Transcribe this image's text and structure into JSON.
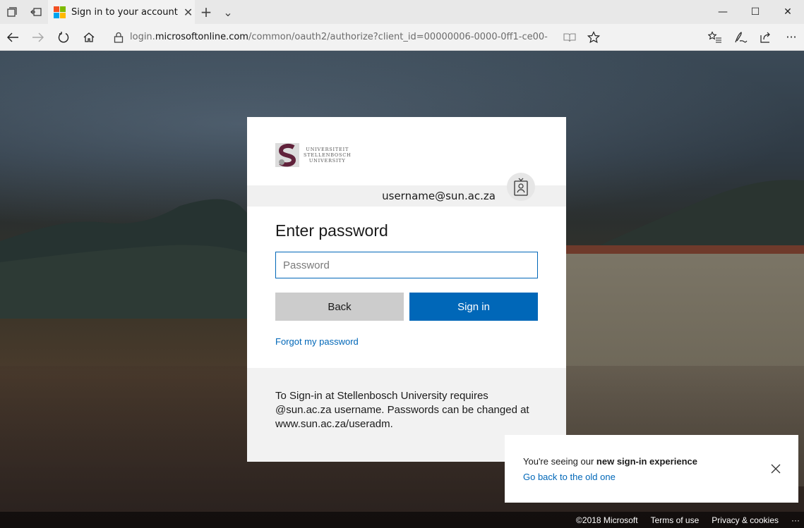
{
  "browser": {
    "tab": {
      "title": "Sign in to your account",
      "close": "✕"
    },
    "new_tab": "+",
    "tab_menu": "⌄",
    "window": {
      "minimize": "—",
      "maximize": "☐",
      "close": "✕"
    },
    "address": {
      "prefix": "login.",
      "domain": "microsoftonline.com",
      "path": "/common/oauth2/authorize?client_id=00000006-0000-0ff1-ce00-"
    },
    "more": "···"
  },
  "card": {
    "logo_lines": [
      "UNIVERSITEIT",
      "STELLENBOSCH",
      "UNIVERSITY"
    ],
    "identity_user": "username@sun.ac.za",
    "heading": "Enter password",
    "password_placeholder": "Password",
    "back_label": "Back",
    "signin_label": "Sign in",
    "forgot_label": "Forgot my password",
    "footer_text": "To Sign-in at Stellenbosch University requires @sun.ac.za username. Passwords can be changed at www.sun.ac.za/useradm."
  },
  "toast": {
    "prefix": "You're seeing our ",
    "bold": "new sign-in experience",
    "link": "Go back to the old one"
  },
  "footer": {
    "copyright": "©2018 Microsoft",
    "terms": "Terms of use",
    "privacy": "Privacy & cookies",
    "more": "···"
  },
  "colors": {
    "accent": "#0067b8",
    "back_button": "#cccccc",
    "brand_maroon": "#61223b"
  }
}
